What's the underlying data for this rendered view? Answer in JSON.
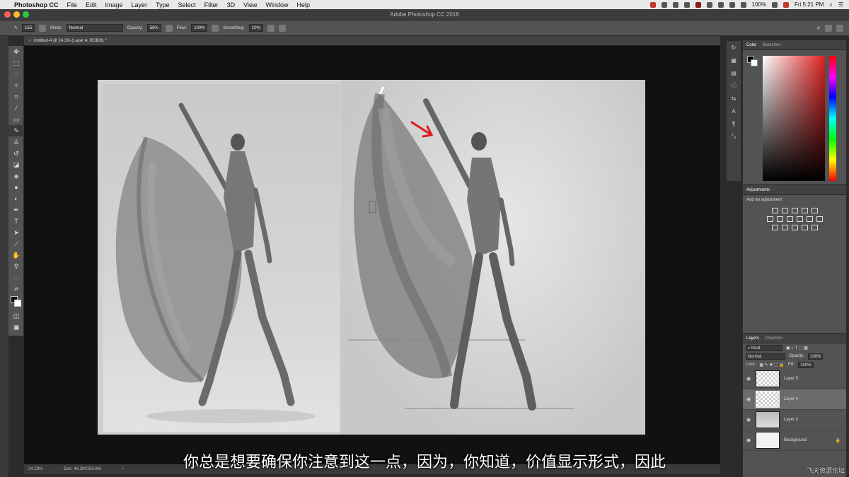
{
  "menubar": {
    "app_name": "Photoshop CC",
    "items": [
      "File",
      "Edit",
      "Image",
      "Layer",
      "Type",
      "Select",
      "Filter",
      "3D",
      "View",
      "Window",
      "Help"
    ],
    "battery": "100%",
    "clock": "Fri 5:21 PM"
  },
  "window": {
    "title": "Adobe Photoshop CC 2018"
  },
  "options_bar": {
    "brush_size": "155",
    "mode_label": "Mode:",
    "mode_value": "Normal",
    "opacity_label": "Opacity:",
    "opacity_value": "56%",
    "flow_label": "Flow:",
    "flow_value": "100%",
    "smoothing_label": "Smoothing:",
    "smoothing_value": "10%"
  },
  "document": {
    "tab_title": "Untitled-4 @ 24.3% (Layer 4, RGB/8) *",
    "zoom": "24.28%",
    "doc_size": "Doc: 48.2M/150.8M"
  },
  "color_panel": {
    "tabs": [
      "Color",
      "Swatches"
    ]
  },
  "adjustments_panel": {
    "title": "Adjustments",
    "add_label": "Add an adjustment"
  },
  "layers_panel": {
    "tabs": [
      "Layers",
      "Channels"
    ],
    "filter_kind": "Kind",
    "blend_mode": "Normal",
    "opacity_label": "Opacity:",
    "opacity_value": "100%",
    "lock_label": "Lock:",
    "fill_label": "Fill:",
    "fill_value": "100%",
    "layers": [
      {
        "name": "Layer 5",
        "selected": false
      },
      {
        "name": "Layer 4",
        "selected": true
      },
      {
        "name": "Layer 3",
        "selected": false
      },
      {
        "name": "Background",
        "selected": false
      }
    ]
  },
  "subtitle": "你总是想要确保你注意到这一点，因为，你知道，价值显示形式，因此",
  "watermark": "飞天资源论坛"
}
